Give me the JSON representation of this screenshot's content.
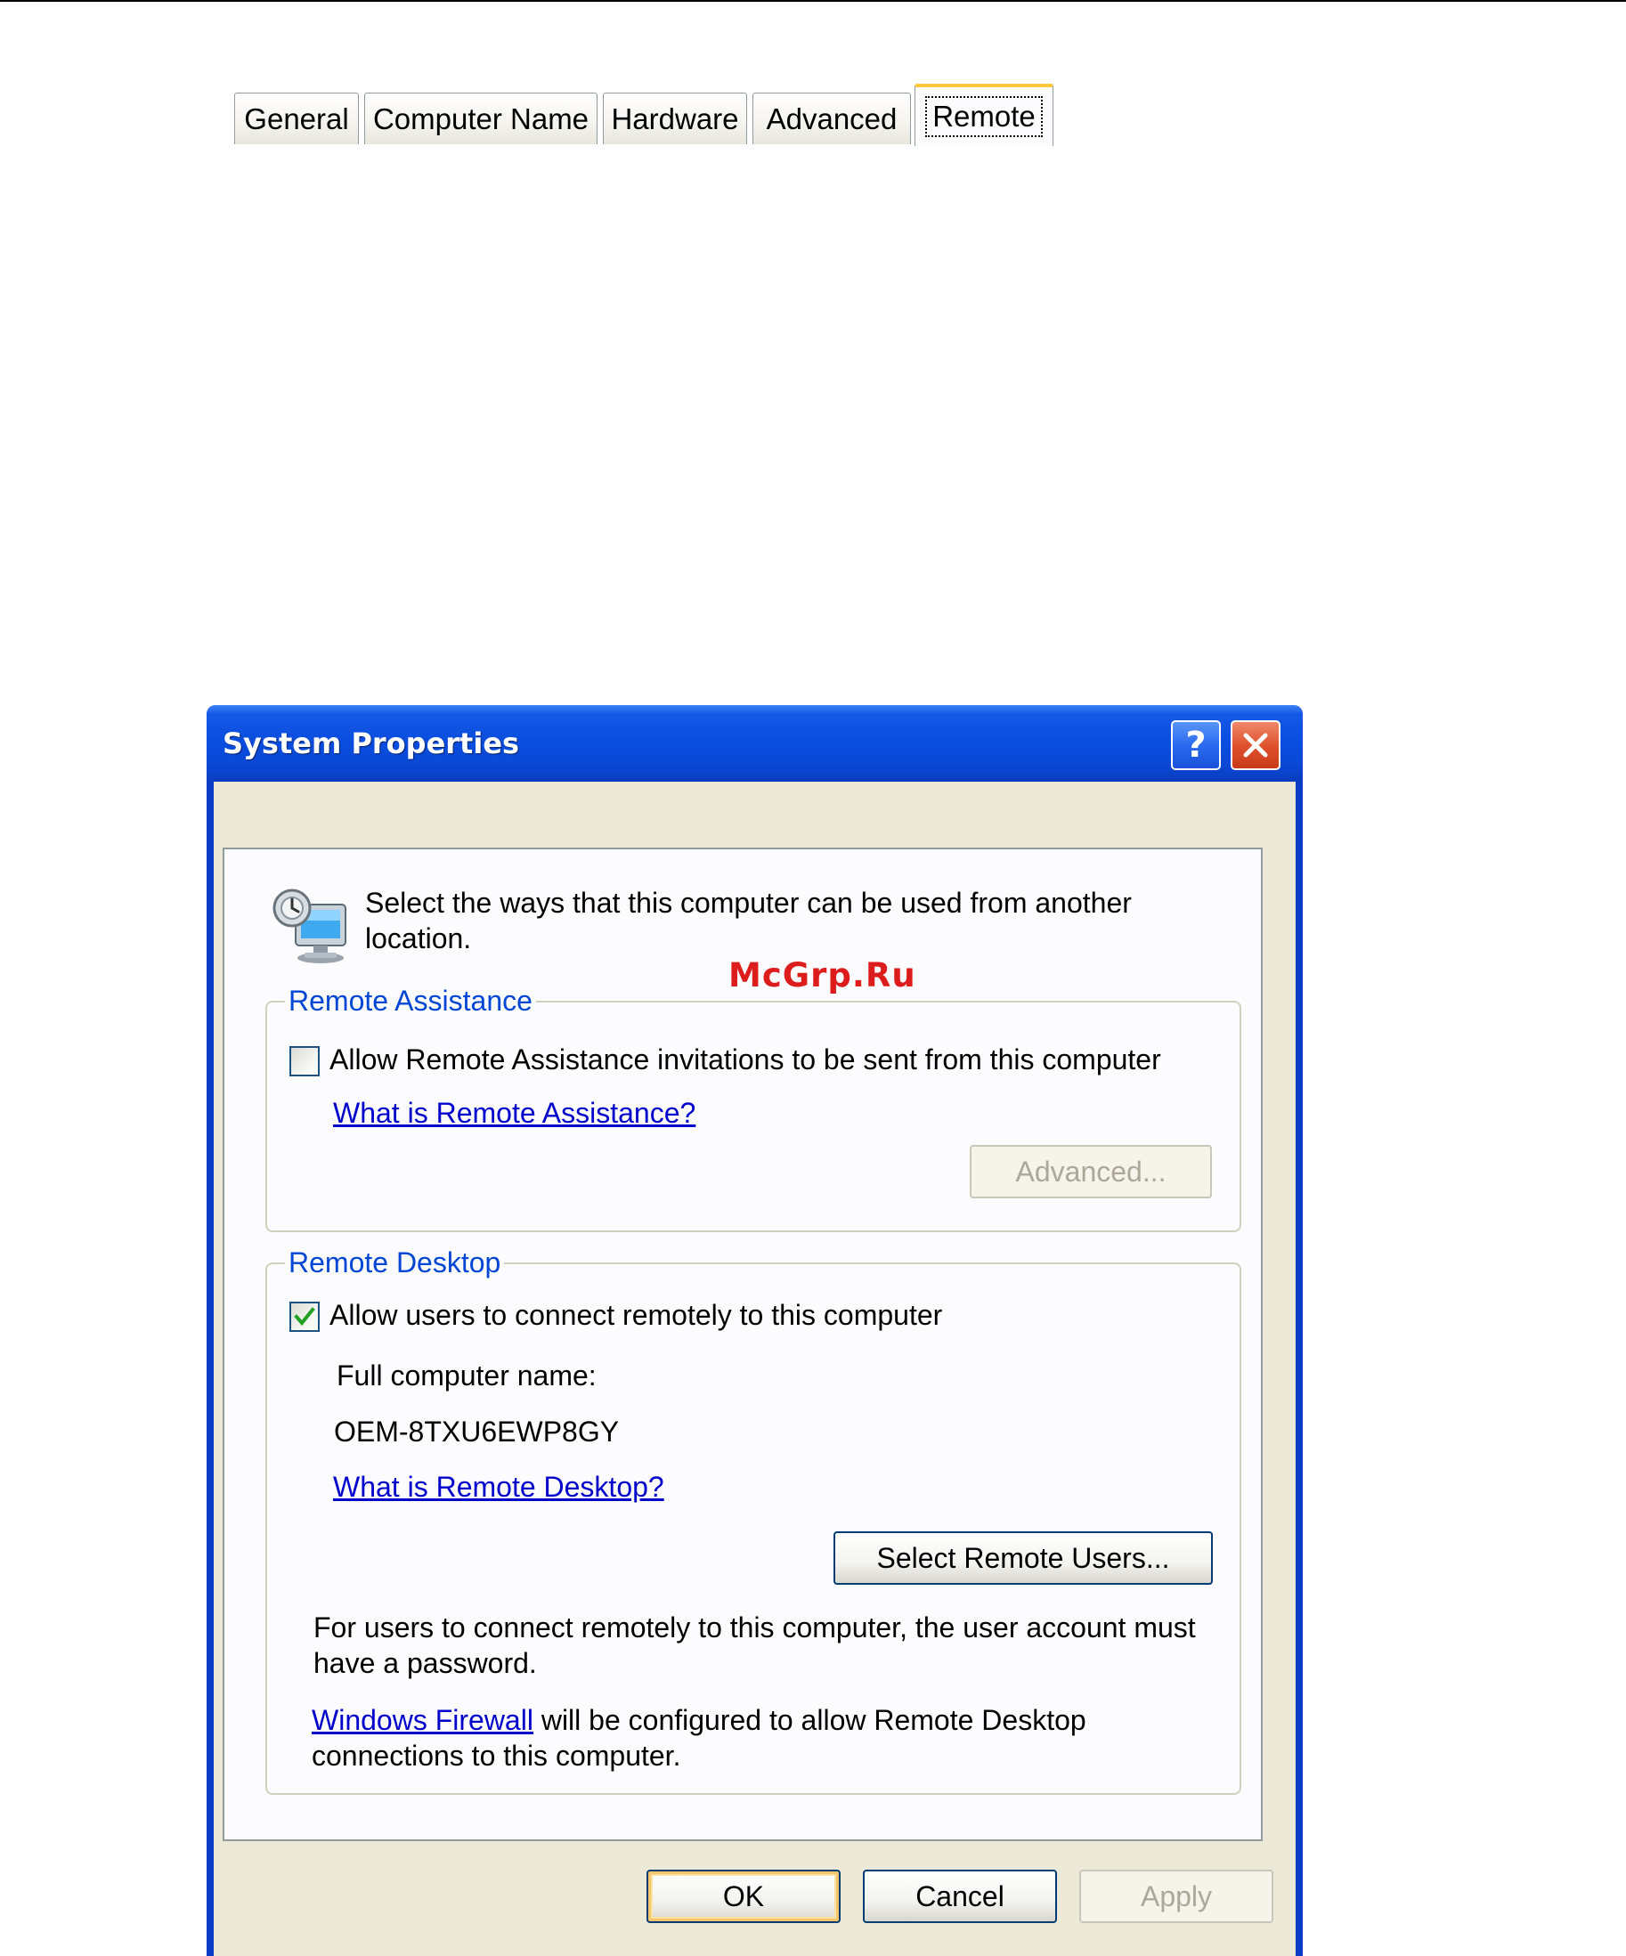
{
  "window": {
    "title": "System Properties",
    "help_glyph": "?",
    "close_glyph": "✕"
  },
  "tabs": [
    {
      "label": "General",
      "active": false
    },
    {
      "label": "Computer Name",
      "active": false
    },
    {
      "label": "Hardware",
      "active": false
    },
    {
      "label": "Advanced",
      "active": false
    },
    {
      "label": "Remote",
      "active": true
    }
  ],
  "intro": {
    "icon": "remote-computer-icon",
    "line1": "Select the ways that this computer can be used from another",
    "line2": "location."
  },
  "remote_assistance": {
    "title": "Remote Assistance",
    "checkbox_label": "Allow Remote Assistance invitations to be sent from this computer",
    "checked": false,
    "link": "What is Remote Assistance?",
    "advanced_button": "Advanced...",
    "advanced_enabled": false
  },
  "remote_desktop": {
    "title": "Remote Desktop",
    "checkbox_label": "Allow users to connect remotely to this computer",
    "checked": true,
    "full_name_label": "Full computer name:",
    "full_name_value": "OEM-8TXU6EWP8GY",
    "link": "What is Remote Desktop?",
    "select_users_button": "Select Remote Users...",
    "password_note_line1": "For users to connect remotely to this computer, the user account must",
    "password_note_line2": "have a password.",
    "firewall_link": "Windows Firewall",
    "firewall_note_rest": " will be configured to allow Remote Desktop",
    "firewall_note_line2": "connections to this computer."
  },
  "buttons": {
    "ok": "OK",
    "cancel": "Cancel",
    "apply": "Apply",
    "apply_enabled": false
  },
  "watermark": "McGrp.Ru",
  "colors": {
    "titlebar": "#0a4ee0",
    "client_bg": "#ece9d8",
    "group_title": "#0046d5",
    "link": "#0000cc",
    "active_tab_accent": "#ffc83c",
    "watermark": "#dd1c1c"
  }
}
